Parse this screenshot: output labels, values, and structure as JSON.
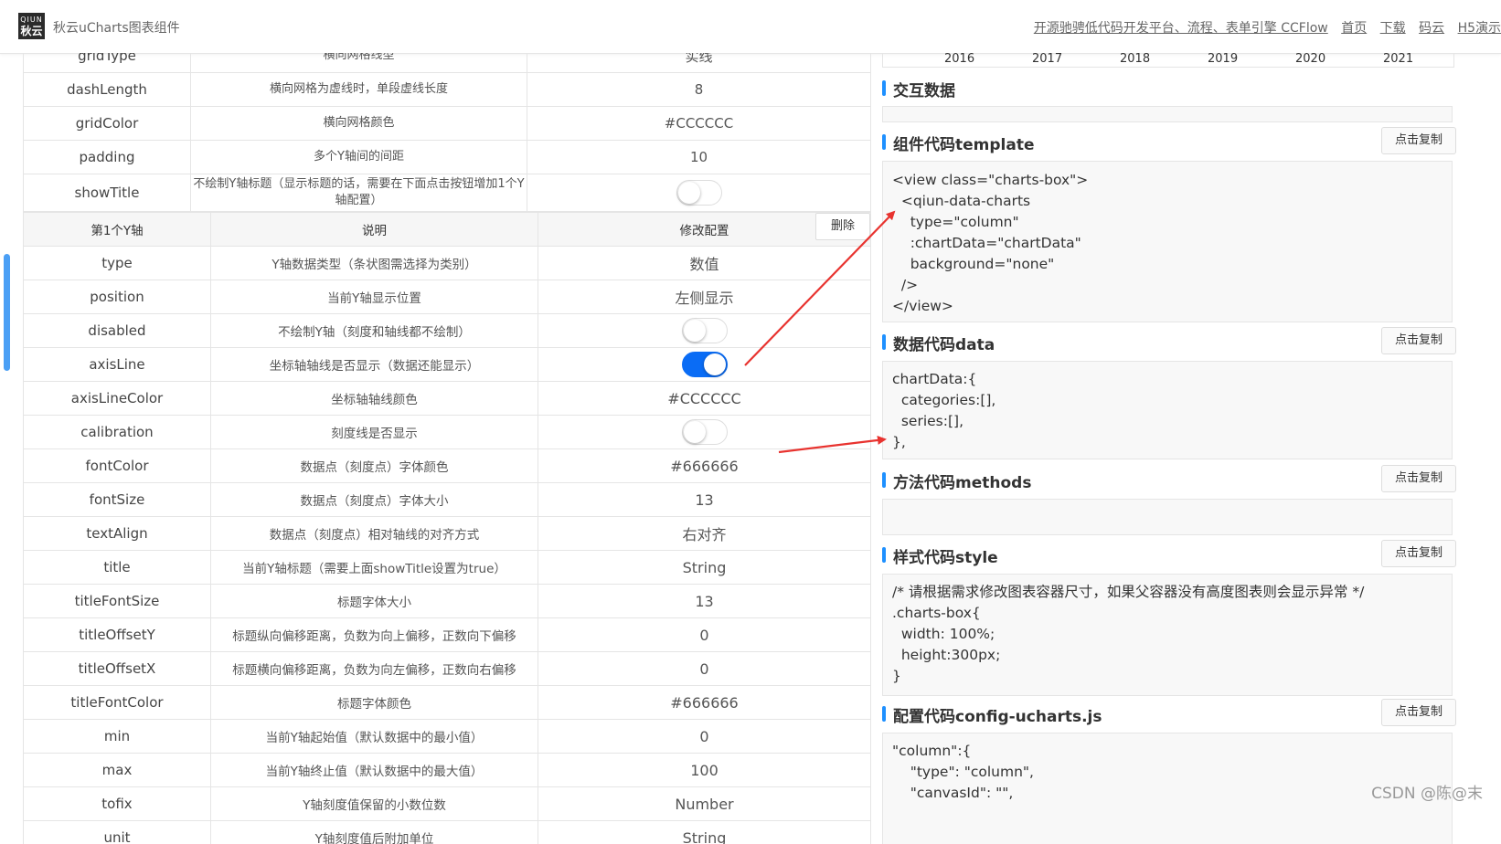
{
  "header": {
    "logo_top": "QIUN",
    "logo_bottom": "秋云",
    "brand": "秋云uCharts图表组件",
    "links": [
      "开源驰骋低代码开发平台、流程、表单引擎 CCFlow",
      "首页",
      "下载",
      "码云",
      "H5演示"
    ]
  },
  "grid_table": {
    "rows": [
      {
        "key": "gridType",
        "desc": "横向网格线型",
        "value": "实线"
      },
      {
        "key": "dashLength",
        "desc": "横向网格为虚线时，单段虚线长度",
        "value": "8"
      },
      {
        "key": "gridColor",
        "desc": "横向网格颜色",
        "value": "#CCCCCC"
      },
      {
        "key": "padding",
        "desc": "多个Y轴间的间距",
        "value": "10"
      },
      {
        "key": "showTitle",
        "desc": "不绘制Y轴标题（显示标题的话，需要在下面点击按钮增加1个Y轴配置）",
        "toggle": false
      }
    ]
  },
  "yaxis_table": {
    "header": {
      "col1": "第1个Y轴",
      "col2": "说明",
      "col3": "修改配置",
      "delete_label": "删除"
    },
    "rows": [
      {
        "key": "type",
        "desc": "Y轴数据类型（条状图需选择为类别）",
        "value": "数值"
      },
      {
        "key": "position",
        "desc": "当前Y轴显示位置",
        "value": "左侧显示"
      },
      {
        "key": "disabled",
        "desc": "不绘制Y轴（刻度和轴线都不绘制）",
        "toggle": false
      },
      {
        "key": "axisLine",
        "desc": "坐标轴轴线是否显示（数据还能显示）",
        "toggle": true
      },
      {
        "key": "axisLineColor",
        "desc": "坐标轴轴线颜色",
        "value": "#CCCCCC"
      },
      {
        "key": "calibration",
        "desc": "刻度线是否显示",
        "toggle": false
      },
      {
        "key": "fontColor",
        "desc": "数据点（刻度点）字体颜色",
        "value": "#666666"
      },
      {
        "key": "fontSize",
        "desc": "数据点（刻度点）字体大小",
        "value": "13"
      },
      {
        "key": "textAlign",
        "desc": "数据点（刻度点）相对轴线的对齐方式",
        "value": "右对齐"
      },
      {
        "key": "title",
        "desc": "当前Y轴标题（需要上面showTitle设置为true）",
        "value": "String"
      },
      {
        "key": "titleFontSize",
        "desc": "标题字体大小",
        "value": "13"
      },
      {
        "key": "titleOffsetY",
        "desc": "标题纵向偏移距离，负数为向上偏移，正数向下偏移",
        "value": "0"
      },
      {
        "key": "titleOffsetX",
        "desc": "标题横向偏移距离，负数为向左偏移，正数向右偏移",
        "value": "0"
      },
      {
        "key": "titleFontColor",
        "desc": "标题字体颜色",
        "value": "#666666"
      },
      {
        "key": "min",
        "desc": "当前Y轴起始值（默认数据中的最小值）",
        "value": "0"
      },
      {
        "key": "max",
        "desc": "当前Y轴终止值（默认数据中的最大值）",
        "value": "100"
      },
      {
        "key": "tofix",
        "desc": "Y轴刻度值保留的小数位数",
        "value": "Number"
      },
      {
        "key": "unit",
        "desc": "Y轴刻度值后附加单位",
        "value": "String"
      }
    ]
  },
  "preview_axis": {
    "years": [
      "2016",
      "2017",
      "2018",
      "2019",
      "2020",
      "2021"
    ]
  },
  "sections": {
    "interact": {
      "title": "交互数据"
    },
    "template": {
      "title": "组件代码template",
      "copy_label": "点击复制",
      "code": "<view class=\"charts-box\">\n  <qiun-data-charts\n    type=\"column\"\n    :chartData=\"chartData\"\n    background=\"none\"\n  />\n</view>"
    },
    "data": {
      "title": "数据代码data",
      "copy_label": "点击复制",
      "code": "chartData:{\n  categories:[],\n  series:[],\n},"
    },
    "methods": {
      "title": "方法代码methods",
      "copy_label": "点击复制",
      "code": ""
    },
    "style": {
      "title": "样式代码style",
      "copy_label": "点击复制",
      "code": "/* 请根据需求修改图表容器尺寸，如果父容器没有高度图表则会显示异常 */\n.charts-box{\n  width: 100%;\n  height:300px;\n}"
    },
    "config": {
      "title": "配置代码config-ucharts.js",
      "copy_label": "点击复制",
      "code": "\"column\":{\n    \"type\": \"column\",\n    \"canvasId\": \"\","
    }
  },
  "watermark": "CSDN @陈@末",
  "colors": {
    "accent": "#1e90ff",
    "toggle_on": "#0a6cf5",
    "arrow": "#e8332f"
  }
}
